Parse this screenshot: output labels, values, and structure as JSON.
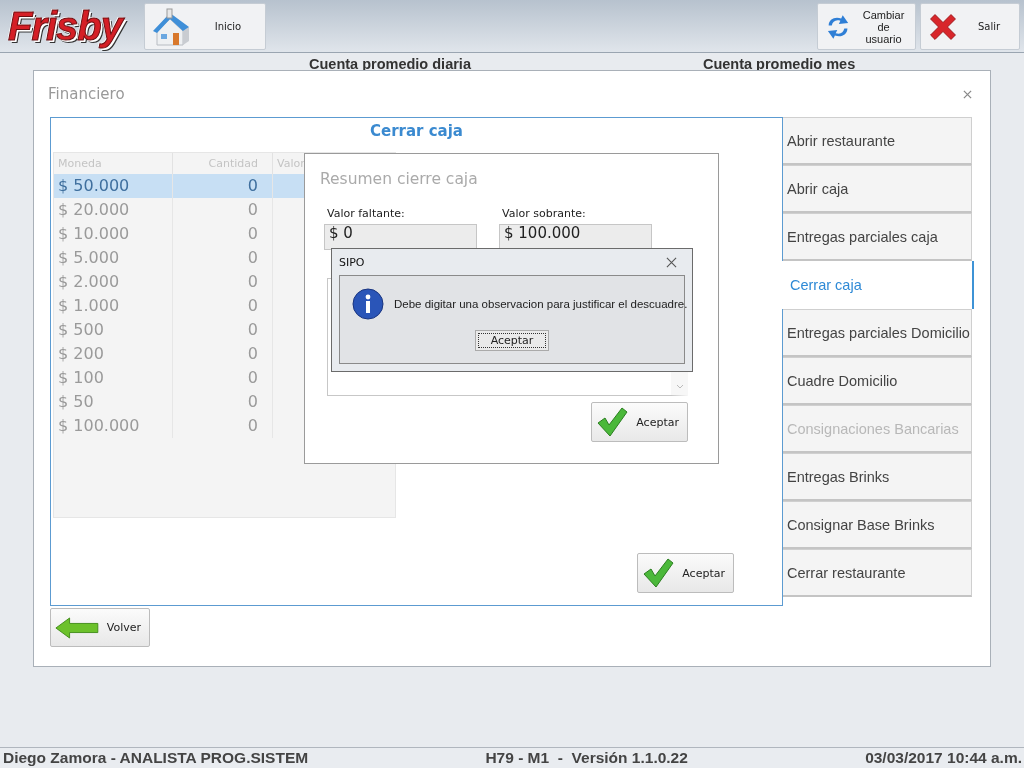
{
  "header": {
    "logo": "Frisby",
    "buttons": [
      {
        "label": "Inicio",
        "kind": "home"
      },
      {
        "label": "Cambiar de usuario",
        "kind": "switch"
      },
      {
        "label": "Salir",
        "kind": "exit"
      }
    ]
  },
  "background": {
    "labels": [
      "Cuenta promedio diaria",
      "Cuenta promedio mes"
    ]
  },
  "window": {
    "title": "Financiero"
  },
  "panel": {
    "title": "Cerrar caja",
    "table": {
      "columns": [
        "Moneda",
        "Cantidad",
        "Valor"
      ],
      "rows": [
        {
          "moneda": "$ 50.000",
          "cantidad": "0",
          "selected": true
        },
        {
          "moneda": "$ 20.000",
          "cantidad": "0",
          "selected": false
        },
        {
          "moneda": "$ 10.000",
          "cantidad": "0",
          "selected": false
        },
        {
          "moneda": "$ 5.000",
          "cantidad": "0",
          "selected": false
        },
        {
          "moneda": "$ 2.000",
          "cantidad": "0",
          "selected": false
        },
        {
          "moneda": "$ 1.000",
          "cantidad": "0",
          "selected": false
        },
        {
          "moneda": "$ 500",
          "cantidad": "0",
          "selected": false
        },
        {
          "moneda": "$ 200",
          "cantidad": "0",
          "selected": false
        },
        {
          "moneda": "$ 100",
          "cantidad": "0",
          "selected": false
        },
        {
          "moneda": "$ 50",
          "cantidad": "0",
          "selected": false
        },
        {
          "moneda": "$ 100.000",
          "cantidad": "0",
          "selected": false
        }
      ]
    },
    "accept": "Aceptar"
  },
  "menu": [
    {
      "label": "Abrir restaurante",
      "selected": false,
      "disabled": false
    },
    {
      "label": "Abrir caja",
      "selected": false,
      "disabled": false
    },
    {
      "label": "Entregas parciales caja",
      "selected": false,
      "disabled": false
    },
    {
      "label": "Cerrar caja",
      "selected": true,
      "disabled": false
    },
    {
      "label": "Entregas parciales Domicilio",
      "selected": false,
      "disabled": false
    },
    {
      "label": "Cuadre Domicilio",
      "selected": false,
      "disabled": false
    },
    {
      "label": "Consignaciones Bancarias",
      "selected": false,
      "disabled": true
    },
    {
      "label": "Entregas Brinks",
      "selected": false,
      "disabled": false
    },
    {
      "label": "Consignar Base Brinks",
      "selected": false,
      "disabled": false
    },
    {
      "label": "Cerrar restaurante",
      "selected": false,
      "disabled": false
    }
  ],
  "back_button": "Volver",
  "summary_dialog": {
    "title": "Resumen cierre caja",
    "fields": [
      {
        "label": "Valor faltante:",
        "value": "$ 0"
      },
      {
        "label": "Valor sobrante:",
        "value": "$ 100.000"
      }
    ],
    "accept": "Aceptar"
  },
  "message_box": {
    "title": "SIPO",
    "message": "Debe digitar una observacion para justificar el descuadre.",
    "button": "Aceptar"
  },
  "status_bar": {
    "user": "Diego Zamora - ANALISTA PROG.SISTEM",
    "version": "H79 - M1  -  Versión 1.1.0.22",
    "datetime": "03/03/2017 10:44 a.m."
  }
}
